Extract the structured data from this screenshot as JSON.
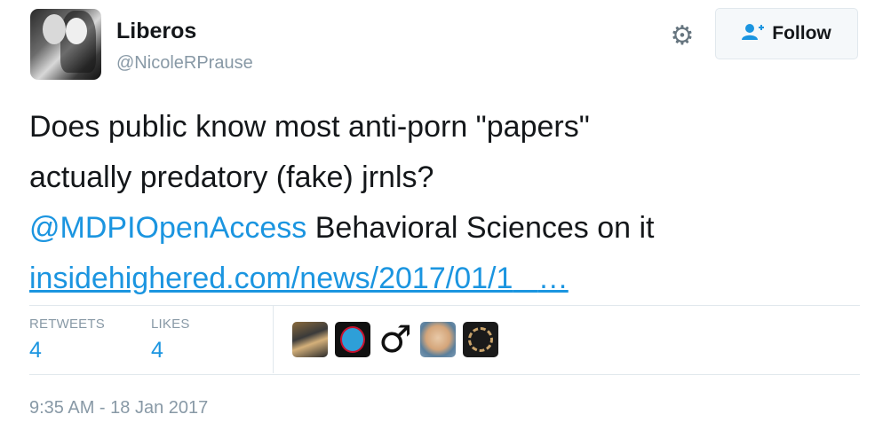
{
  "user": {
    "display_name": "Liberos",
    "handle": "@NicoleRPrause"
  },
  "actions": {
    "settings_icon": "gear-icon",
    "follow_icon": "follow-person-icon",
    "follow_label": "Follow"
  },
  "tweet": {
    "line1": "Does public know most anti-porn \"papers\"",
    "line2": "actually predatory (fake) jrnls?",
    "mention": "@MDPIOpenAccess",
    "line3_rest": " Behavioral Sciences on it",
    "link_text": "insidehighered.com/news/2017/01/1",
    "link_ellipsis": "…"
  },
  "stats": {
    "retweets_label": "RETWEETS",
    "retweets_count": "4",
    "likes_label": "LIKES",
    "likes_count": "4"
  },
  "likers": [
    "liker-avatar-1",
    "liker-avatar-2",
    "liker-avatar-3",
    "liker-avatar-4",
    "liker-avatar-5"
  ],
  "timestamp": "9:35 AM - 18 Jan 2017",
  "colors": {
    "link": "#1b95e0",
    "muted": "#8899a6",
    "text": "#14171a"
  }
}
